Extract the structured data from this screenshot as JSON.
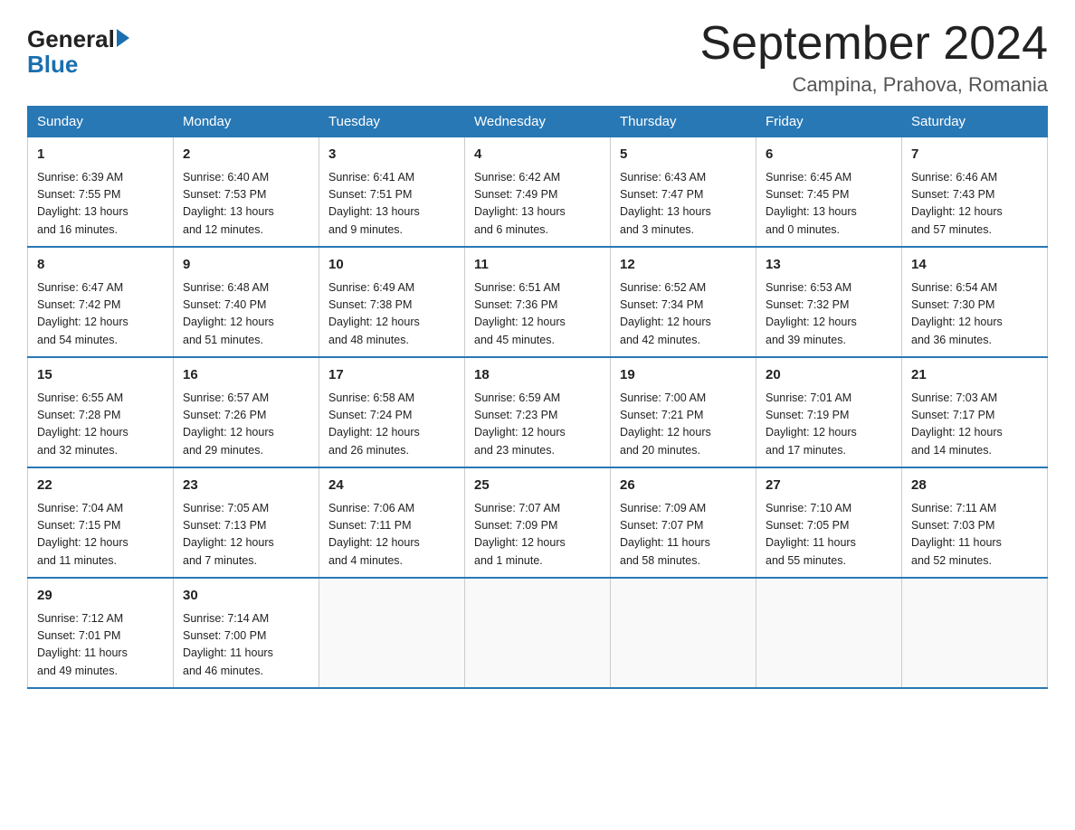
{
  "logo": {
    "general": "General",
    "blue": "Blue"
  },
  "title": {
    "month_year": "September 2024",
    "location": "Campina, Prahova, Romania"
  },
  "headers": [
    "Sunday",
    "Monday",
    "Tuesday",
    "Wednesday",
    "Thursday",
    "Friday",
    "Saturday"
  ],
  "weeks": [
    [
      {
        "day": "1",
        "info": "Sunrise: 6:39 AM\nSunset: 7:55 PM\nDaylight: 13 hours\nand 16 minutes."
      },
      {
        "day": "2",
        "info": "Sunrise: 6:40 AM\nSunset: 7:53 PM\nDaylight: 13 hours\nand 12 minutes."
      },
      {
        "day": "3",
        "info": "Sunrise: 6:41 AM\nSunset: 7:51 PM\nDaylight: 13 hours\nand 9 minutes."
      },
      {
        "day": "4",
        "info": "Sunrise: 6:42 AM\nSunset: 7:49 PM\nDaylight: 13 hours\nand 6 minutes."
      },
      {
        "day": "5",
        "info": "Sunrise: 6:43 AM\nSunset: 7:47 PM\nDaylight: 13 hours\nand 3 minutes."
      },
      {
        "day": "6",
        "info": "Sunrise: 6:45 AM\nSunset: 7:45 PM\nDaylight: 13 hours\nand 0 minutes."
      },
      {
        "day": "7",
        "info": "Sunrise: 6:46 AM\nSunset: 7:43 PM\nDaylight: 12 hours\nand 57 minutes."
      }
    ],
    [
      {
        "day": "8",
        "info": "Sunrise: 6:47 AM\nSunset: 7:42 PM\nDaylight: 12 hours\nand 54 minutes."
      },
      {
        "day": "9",
        "info": "Sunrise: 6:48 AM\nSunset: 7:40 PM\nDaylight: 12 hours\nand 51 minutes."
      },
      {
        "day": "10",
        "info": "Sunrise: 6:49 AM\nSunset: 7:38 PM\nDaylight: 12 hours\nand 48 minutes."
      },
      {
        "day": "11",
        "info": "Sunrise: 6:51 AM\nSunset: 7:36 PM\nDaylight: 12 hours\nand 45 minutes."
      },
      {
        "day": "12",
        "info": "Sunrise: 6:52 AM\nSunset: 7:34 PM\nDaylight: 12 hours\nand 42 minutes."
      },
      {
        "day": "13",
        "info": "Sunrise: 6:53 AM\nSunset: 7:32 PM\nDaylight: 12 hours\nand 39 minutes."
      },
      {
        "day": "14",
        "info": "Sunrise: 6:54 AM\nSunset: 7:30 PM\nDaylight: 12 hours\nand 36 minutes."
      }
    ],
    [
      {
        "day": "15",
        "info": "Sunrise: 6:55 AM\nSunset: 7:28 PM\nDaylight: 12 hours\nand 32 minutes."
      },
      {
        "day": "16",
        "info": "Sunrise: 6:57 AM\nSunset: 7:26 PM\nDaylight: 12 hours\nand 29 minutes."
      },
      {
        "day": "17",
        "info": "Sunrise: 6:58 AM\nSunset: 7:24 PM\nDaylight: 12 hours\nand 26 minutes."
      },
      {
        "day": "18",
        "info": "Sunrise: 6:59 AM\nSunset: 7:23 PM\nDaylight: 12 hours\nand 23 minutes."
      },
      {
        "day": "19",
        "info": "Sunrise: 7:00 AM\nSunset: 7:21 PM\nDaylight: 12 hours\nand 20 minutes."
      },
      {
        "day": "20",
        "info": "Sunrise: 7:01 AM\nSunset: 7:19 PM\nDaylight: 12 hours\nand 17 minutes."
      },
      {
        "day": "21",
        "info": "Sunrise: 7:03 AM\nSunset: 7:17 PM\nDaylight: 12 hours\nand 14 minutes."
      }
    ],
    [
      {
        "day": "22",
        "info": "Sunrise: 7:04 AM\nSunset: 7:15 PM\nDaylight: 12 hours\nand 11 minutes."
      },
      {
        "day": "23",
        "info": "Sunrise: 7:05 AM\nSunset: 7:13 PM\nDaylight: 12 hours\nand 7 minutes."
      },
      {
        "day": "24",
        "info": "Sunrise: 7:06 AM\nSunset: 7:11 PM\nDaylight: 12 hours\nand 4 minutes."
      },
      {
        "day": "25",
        "info": "Sunrise: 7:07 AM\nSunset: 7:09 PM\nDaylight: 12 hours\nand 1 minute."
      },
      {
        "day": "26",
        "info": "Sunrise: 7:09 AM\nSunset: 7:07 PM\nDaylight: 11 hours\nand 58 minutes."
      },
      {
        "day": "27",
        "info": "Sunrise: 7:10 AM\nSunset: 7:05 PM\nDaylight: 11 hours\nand 55 minutes."
      },
      {
        "day": "28",
        "info": "Sunrise: 7:11 AM\nSunset: 7:03 PM\nDaylight: 11 hours\nand 52 minutes."
      }
    ],
    [
      {
        "day": "29",
        "info": "Sunrise: 7:12 AM\nSunset: 7:01 PM\nDaylight: 11 hours\nand 49 minutes."
      },
      {
        "day": "30",
        "info": "Sunrise: 7:14 AM\nSunset: 7:00 PM\nDaylight: 11 hours\nand 46 minutes."
      },
      {
        "day": "",
        "info": ""
      },
      {
        "day": "",
        "info": ""
      },
      {
        "day": "",
        "info": ""
      },
      {
        "day": "",
        "info": ""
      },
      {
        "day": "",
        "info": ""
      }
    ]
  ]
}
